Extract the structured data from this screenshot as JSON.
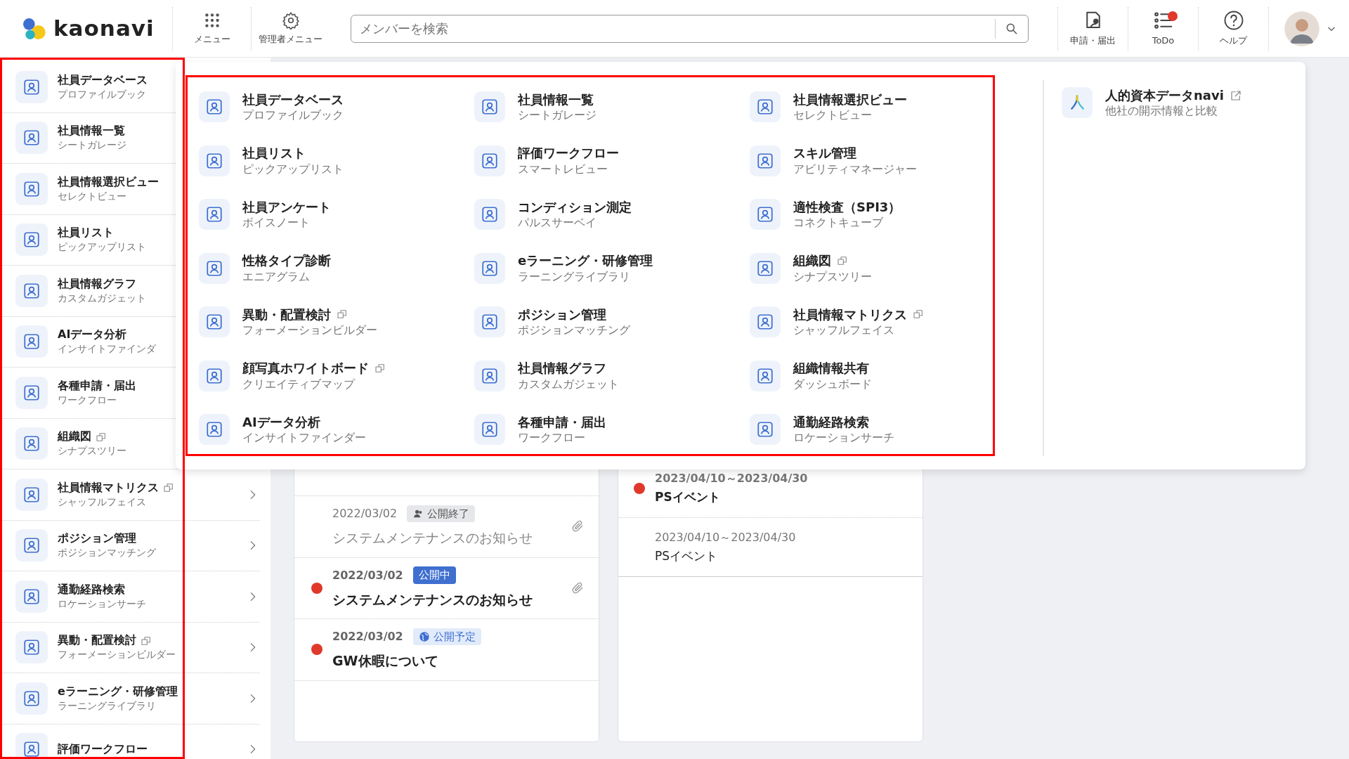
{
  "header": {
    "logo": "kaonavi",
    "menu_buttons": [
      {
        "label": "メニュー",
        "kind": "grid"
      },
      {
        "label": "管理者メニュー",
        "kind": "gear"
      }
    ],
    "search": {
      "placeholder": "メンバーを検索"
    },
    "tools": [
      {
        "label": "申請・届出",
        "kind": "request",
        "badge": false
      },
      {
        "label": "ToDo",
        "kind": "todo",
        "badge": true
      },
      {
        "label": "ヘルプ",
        "kind": "help",
        "badge": false
      }
    ]
  },
  "sidebar": {
    "items": [
      {
        "title": "社員データベース",
        "sub": "プロファイルブック",
        "external": false
      },
      {
        "title": "社員情報一覧",
        "sub": "シートガレージ",
        "external": false
      },
      {
        "title": "社員情報選択ビュー",
        "sub": "セレクトビュー",
        "external": false
      },
      {
        "title": "社員リスト",
        "sub": "ピックアップリスト",
        "external": false
      },
      {
        "title": "社員情報グラフ",
        "sub": "カスタムガジェット",
        "external": false
      },
      {
        "title": "AIデータ分析",
        "sub": "インサイトファインダ",
        "external": false
      },
      {
        "title": "各種申請・届出",
        "sub": "ワークフロー",
        "external": false
      },
      {
        "title": "組織図",
        "sub": "シナプスツリー",
        "external": true
      },
      {
        "title": "社員情報マトリクス",
        "sub": "シャッフルフェイス",
        "external": true
      },
      {
        "title": "ポジション管理",
        "sub": "ポジションマッチング",
        "external": false
      },
      {
        "title": "通勤経路検索",
        "sub": "ロケーションサーチ",
        "external": false
      },
      {
        "title": "異動・配置検討",
        "sub": "フォーメーションビルダー",
        "external": true
      },
      {
        "title": "eラーニング・研修管理",
        "sub": "ラーニングライブラリ",
        "external": false
      },
      {
        "title": "評価ワークフロー",
        "external": false
      }
    ]
  },
  "menu_panel": {
    "items": [
      {
        "title": "社員データベース",
        "sub": "プロファイルブック",
        "external": false
      },
      {
        "title": "社員情報一覧",
        "sub": "シートガレージ",
        "external": false
      },
      {
        "title": "社員情報選択ビュー",
        "sub": "セレクトビュー",
        "external": false
      },
      {
        "title": "社員リスト",
        "sub": "ピックアップリスト",
        "external": false
      },
      {
        "title": "評価ワークフロー",
        "sub": "スマートレビュー",
        "external": false
      },
      {
        "title": "スキル管理",
        "sub": "アビリティマネージャー",
        "external": false
      },
      {
        "title": "社員アンケート",
        "sub": "ボイスノート",
        "external": false
      },
      {
        "title": "コンディション測定",
        "sub": "パルスサーベイ",
        "external": false
      },
      {
        "title": "適性検査（SPI3）",
        "sub": "コネクトキューブ",
        "external": false
      },
      {
        "title": "性格タイプ診断",
        "sub": "エニアグラム",
        "external": false
      },
      {
        "title": "eラーニング・研修管理",
        "sub": "ラーニングライブラリ",
        "external": false
      },
      {
        "title": "組織図",
        "sub": "シナプスツリー",
        "external": true
      },
      {
        "title": "異動・配置検討",
        "sub": "フォーメーションビルダー",
        "external": true
      },
      {
        "title": "ポジション管理",
        "sub": "ポジションマッチング",
        "external": false
      },
      {
        "title": "社員情報マトリクス",
        "sub": "シャッフルフェイス",
        "external": true
      },
      {
        "title": "顔写真ホワイトボード",
        "sub": "クリエイティブマップ",
        "external": true
      },
      {
        "title": "社員情報グラフ",
        "sub": "カスタムガジェット",
        "external": false
      },
      {
        "title": "組織情報共有",
        "sub": "ダッシュボード",
        "external": false
      },
      {
        "title": "AIデータ分析",
        "sub": "インサイトファインダー",
        "external": false
      },
      {
        "title": "各種申請・届出",
        "sub": "ワークフロー",
        "external": false
      },
      {
        "title": "通勤経路検索",
        "sub": "ロケーションサーチ",
        "external": false
      }
    ],
    "side_item": {
      "title": "人的資本データnavi",
      "sub": "他社の開示情報と比較",
      "external": true
    }
  },
  "notices": [
    {
      "date": "2022/03/02",
      "status": "公開終了",
      "kind": "ended",
      "title": "システムメンテナンスのお知らせ",
      "unread": false,
      "attachment": true
    },
    {
      "date": "2022/03/02",
      "status": "公開中",
      "kind": "public",
      "title": "システムメンテナンスのお知らせ",
      "unread": true,
      "attachment": true
    },
    {
      "date": "2022/03/02",
      "status": "公開予定",
      "kind": "scheduled",
      "title": "GW休暇について",
      "unread": true,
      "attachment": false
    }
  ],
  "events": [
    {
      "period": "2023/04/10～2023/04/30",
      "title": "PSイベント",
      "unread": true
    },
    {
      "period": "2023/04/10～2023/04/30",
      "title": "PSイベント",
      "unread": false
    }
  ]
}
